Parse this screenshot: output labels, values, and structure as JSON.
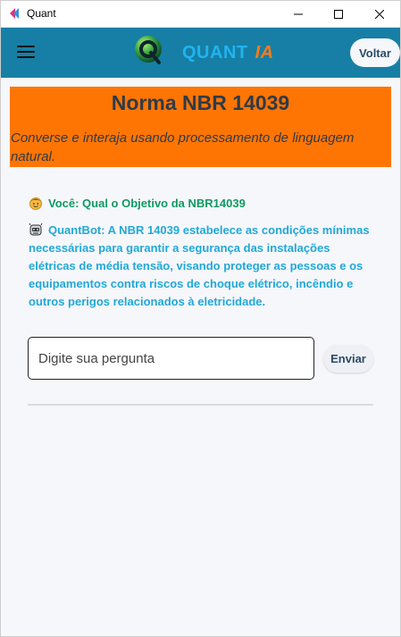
{
  "window": {
    "title": "Quant",
    "icon": "app-logo-icon",
    "controls": [
      "minimize-icon",
      "maximize-icon",
      "close-icon"
    ]
  },
  "appbar": {
    "menu_icon": "menu-icon",
    "logo_icon": "quant-logo-icon",
    "brand_main": "QUANT",
    "brand_accent": "IA",
    "back_label": "Voltar",
    "colors": {
      "bar": "#177fa5",
      "brand_main": "#20b4f0",
      "brand_accent": "#ff7a17"
    }
  },
  "banner": {
    "title": "Norma NBR 14039",
    "subtitle": "Converse e interaja usando processamento de linguagem natural.",
    "color": "#ff7503"
  },
  "chat": {
    "messages": [
      {
        "role": "user",
        "icon": "user-face-icon",
        "text": "Você: Qual o Objetivo da NBR14039",
        "color": "#0f9a63"
      },
      {
        "role": "bot",
        "icon": "robot-icon",
        "text": "QuantBot: A NBR 14039 estabelece as condições mínimas necessárias para garantir a segurança das instalações elétricas de média tensão, visando proteger as pessoas e os equipamentos contra riscos de choque elétrico, incêndio e outros perigos relacionados à eletricidade.",
        "color": "#21a8d8"
      }
    ],
    "input": {
      "placeholder": "Digite sua pergunta",
      "value": ""
    },
    "send_label": "Enviar"
  }
}
